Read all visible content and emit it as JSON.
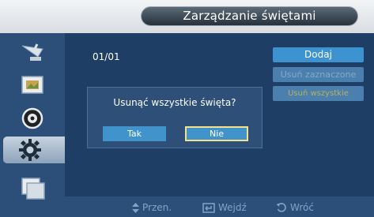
{
  "header": {
    "title": "Zarządzanie świętami"
  },
  "counter": "01/01",
  "actions": {
    "add": "Dodaj",
    "remove_selected": "Usuń zaznaczone",
    "remove_all": "Usuń wszystkie"
  },
  "dialog": {
    "message": "Usunąć wszystkie święta?",
    "yes": "Tak",
    "no": "Nie"
  },
  "hints": {
    "move": "Przen.",
    "enter": "Wejdź",
    "back": "Wróć"
  },
  "sidebar": {
    "items": [
      {
        "icon": "satellite-dish-icon"
      },
      {
        "icon": "picture-icon"
      },
      {
        "icon": "sound-icon"
      },
      {
        "icon": "settings-gear-icon",
        "active": true
      },
      {
        "icon": "multi-display-icon"
      }
    ]
  }
}
